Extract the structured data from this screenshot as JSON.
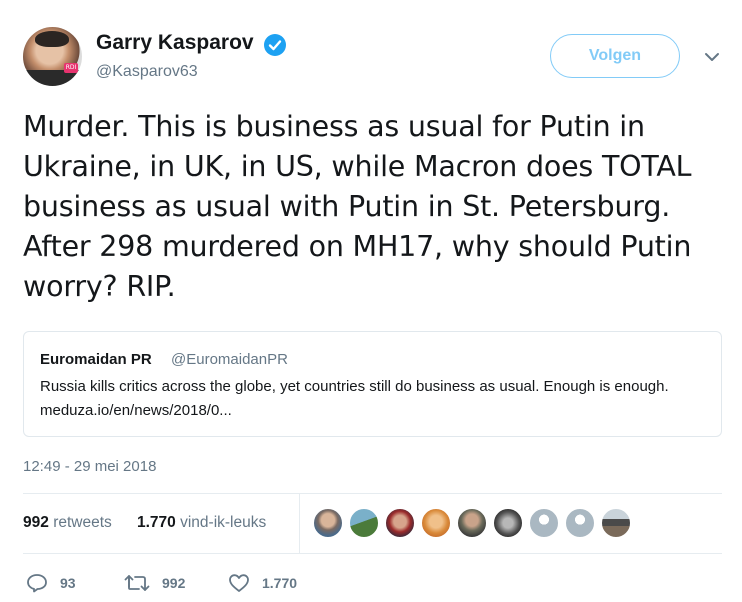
{
  "author": {
    "name": "Garry Kasparov",
    "handle": "@Kasparov63",
    "verified": true,
    "avatar_badge": "RDI"
  },
  "follow_button": {
    "label": "Volgen"
  },
  "menu_icon": "chevron-down-icon",
  "tweet": {
    "text": "Murder. This is business as usual for Putin in Ukraine, in UK, in US, while Macron does TOTAL business as usual with Putin in St. Petersburg. After 298 murdered on MH17, why should Putin worry? RIP."
  },
  "quote": {
    "name": "Euromaidan PR",
    "handle": "@EuromaidanPR",
    "text": "Russia kills critics across the globe, yet countries still do business as usual. Enough is enough.   meduza.io/en/news/2018/0..."
  },
  "timestamp": "12:49 - 29 mei 2018",
  "stats": {
    "retweets_count": "992",
    "retweets_label": "retweets",
    "likes_count": "1.770",
    "likes_label": "vind-ik-leuks"
  },
  "actions": {
    "replies": "93",
    "retweets": "992",
    "likes": "1.770"
  },
  "colors": {
    "accent": "#1da1f2",
    "text": "#14171a",
    "muted": "#657786",
    "border": "#e1e8ed"
  }
}
